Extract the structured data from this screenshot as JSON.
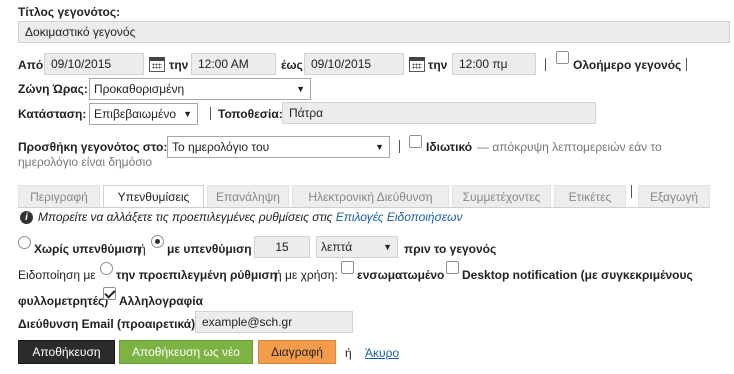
{
  "title_label": "Τίτλος γεγονότος:",
  "title_value": "Δοκιμαστικό γεγονός",
  "from_label": "Από",
  "start_date": "09/10/2015",
  "tin1": "την",
  "start_time": "12:00 AM",
  "until_label": "έως",
  "end_date": "09/10/2015",
  "tin2": "την",
  "end_time": "12:00 πμ",
  "all_day_label": "Ολοήμερο γεγονός",
  "timezone_label": "Ζώνη Ώρας:",
  "timezone_value": "Προκαθορισμένη",
  "status_label": "Κατάσταση:",
  "status_value": "Επιβεβαιωμένο",
  "location_label": "Τοποθεσία:",
  "location_value": "Πάτρα",
  "calendar_label": "Προσθήκη γεγονότος στο:",
  "calendar_value": "Το ημερολόγιο του",
  "private_label": "Ιδιωτικό",
  "private_hint_1": "— απόκρυψη λεπτομερειών εάν το",
  "private_hint_2": "ημερολόγιο είναι δημόσιο",
  "tabs": [
    {
      "label": "Περιγραφή"
    },
    {
      "label": "Υπενθυμίσεις"
    },
    {
      "label": "Επανάληψη"
    },
    {
      "label": "Ηλεκτρονική Διεύθυνση"
    },
    {
      "label": "Συμμετέχοντες"
    },
    {
      "label": "Ετικέτες"
    },
    {
      "label": "Εξαγωγή"
    }
  ],
  "info_text_1": "Μπορείτε να αλλάξετε τις προεπιλεγμένες ρυθμίσεις στις",
  "info_link": "Επιλογές Ειδοποιήσεων",
  "no_reminder_label": "Χωρίς υπενθύμιση",
  "or_1": "ή",
  "with_reminder_label": "με υπενθύμιση",
  "reminder_amount": "15",
  "reminder_unit": "λεπτά",
  "before_event": "πριν το γεγονός",
  "notify_with": "Ειδοποίηση με",
  "default_setting": "την προεπιλεγμένη ρύθμιση",
  "or_use": "ή με χρήση:",
  "embedded_label": "ενσωματωμένο",
  "desktop_label_1": "Desktop notification (με συγκεκριμένους",
  "desktop_label_2": "φυλλομετρητές)",
  "email_label": "Αλληλογραφία",
  "email_addr_label": "Διεύθυνση Email (προαιρετικά)",
  "email_addr_value": "example@sch.gr",
  "btn_save": "Αποθήκευση",
  "btn_save_new": "Αποθήκευση ως νέο",
  "btn_delete": "Διαγραφή",
  "or_2": "ή",
  "cancel_link": "Άκυρο",
  "colors": {
    "save": "#2b2b2b",
    "save_new": "#7cb342",
    "delete": "#f39c4a",
    "link": "#1a5ea8"
  },
  "icons": [
    "calendar-icon",
    "info-icon",
    "dropdown-caret-icon"
  ]
}
